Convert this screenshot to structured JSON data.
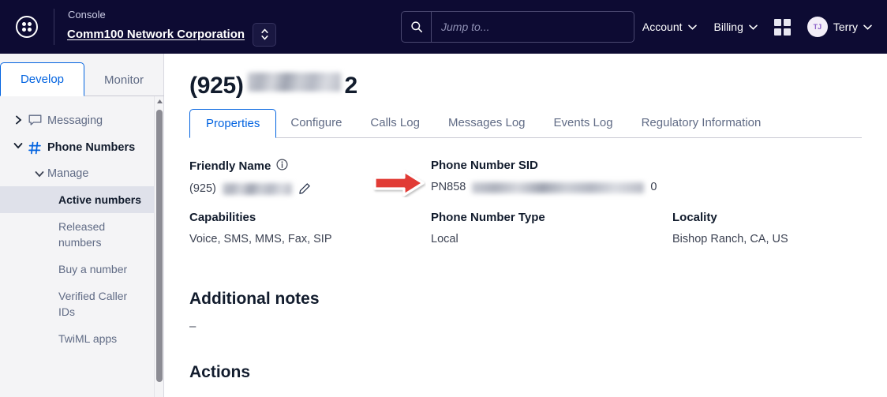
{
  "header": {
    "logo_icon": "grid-circle-icon",
    "console_label": "Console",
    "org_name": "Comm100 Network Corporation",
    "org_switch_icon": "up-down-chevron-icon",
    "search": {
      "icon": "search-icon",
      "placeholder": "Jump to...",
      "value": ""
    },
    "menus": [
      {
        "label": "Account",
        "icon": "chevron-down-icon"
      },
      {
        "label": "Billing",
        "icon": "chevron-down-icon"
      }
    ],
    "grid_icon": "apps-grid-icon",
    "user": {
      "initials": "TJ",
      "name": "Terry",
      "icon": "chevron-down-icon"
    }
  },
  "sidebar": {
    "tabs": [
      {
        "label": "Develop",
        "active": true
      },
      {
        "label": "Monitor",
        "active": false
      }
    ],
    "nav": [
      {
        "label": "Messaging",
        "icon": "chat-bubble-icon",
        "chevron": "chevron-right-icon",
        "expanded": false,
        "current": false
      },
      {
        "label": "Phone Numbers",
        "icon": "hash-icon",
        "chevron": "chevron-down-icon",
        "expanded": true,
        "current": true
      }
    ],
    "subgroup": {
      "label": "Manage",
      "chevron": "chevron-down-icon"
    },
    "leaves": [
      {
        "label": "Active numbers",
        "selected": true
      },
      {
        "label": "Released numbers",
        "selected": false
      },
      {
        "label": "Buy a number",
        "selected": false
      },
      {
        "label": "Verified Caller IDs",
        "selected": false
      },
      {
        "label": "TwiML apps",
        "selected": false
      }
    ],
    "scrollbar": {
      "up_icon": "scroll-up-arrow-icon"
    }
  },
  "main": {
    "title_prefix": "(925)",
    "title_suffix": "2",
    "title_redacted": true,
    "tabs": [
      {
        "label": "Properties",
        "active": true
      },
      {
        "label": "Configure",
        "active": false
      },
      {
        "label": "Calls Log",
        "active": false
      },
      {
        "label": "Messages Log",
        "active": false
      },
      {
        "label": "Events Log",
        "active": false
      },
      {
        "label": "Regulatory Information",
        "active": false
      }
    ],
    "properties": {
      "friendly_name": {
        "label": "Friendly Name",
        "info_icon": "info-circle-icon",
        "value_prefix": "(925)",
        "value_redacted": true,
        "edit_icon": "pencil-icon"
      },
      "phone_number_sid": {
        "label": "Phone Number SID",
        "value_prefix": "PN858",
        "value_suffix": "0",
        "value_redacted": true
      },
      "capabilities": {
        "label": "Capabilities",
        "value": "Voice, SMS, MMS, Fax, SIP"
      },
      "phone_number_type": {
        "label": "Phone Number Type",
        "value": "Local"
      },
      "locality": {
        "label": "Locality",
        "value": "Bishop Ranch, CA, US"
      }
    },
    "additional_notes": {
      "heading": "Additional notes",
      "value": "–"
    },
    "actions": {
      "heading": "Actions"
    }
  },
  "annotation": {
    "arrow_icon": "red-right-arrow-icon",
    "color": "#e13b36",
    "points_at": "phone-number-sid-value"
  },
  "colors": {
    "header_bg": "#0d0b33",
    "sidebar_bg": "#f4f4f6",
    "accent_blue": "#0263e0",
    "text_dark": "#121c2d",
    "text_muted": "#606b85",
    "selected_bg": "#dfe1ea",
    "annotation_red": "#e13b36"
  }
}
